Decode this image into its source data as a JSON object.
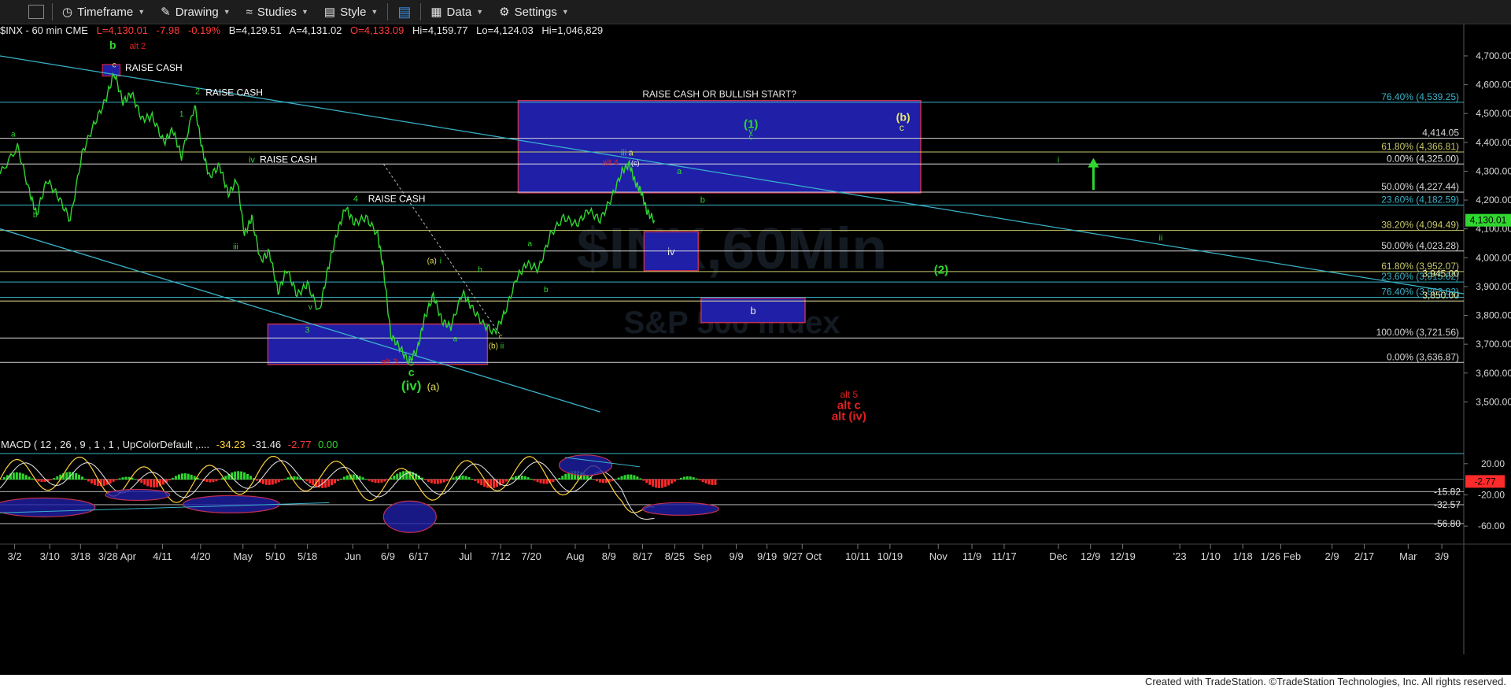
{
  "toolbar": {
    "timeframe": "Timeframe",
    "drawing": "Drawing",
    "studies": "Studies",
    "style": "Style",
    "data": "Data",
    "settings": "Settings"
  },
  "info": {
    "symbol": "$INX - 60 min  CME",
    "last": "L=4,130.01",
    "chg": "-7.98",
    "pct": "-0.19%",
    "bid": "B=4,129.51",
    "ask": "A=4,131.02",
    "open": "O=4,133.09",
    "high": "Hi=4,159.77",
    "low": "Lo=4,124.03",
    "vol": "Hi=1,046,829"
  },
  "footer": "Created with TradeStation. ©TradeStation Technologies, Inc. All rights reserved.",
  "watermark": {
    "line1": "$INX,60Min",
    "line2": "S&P 500 Index"
  },
  "chart_data": {
    "type": "line",
    "price_axis": {
      "ylim": [
        3430,
        4760
      ],
      "ticks": [
        3500,
        3600,
        3700,
        3800,
        3900,
        4000,
        4100,
        4200,
        4300,
        4400,
        4500,
        4600,
        4700
      ],
      "tick_labels": [
        "3,500.00",
        "3,600.00",
        "3,700.00",
        "3,800.00",
        "3,900.00",
        "4,000.00",
        "4,100.00",
        "4,200.00",
        "4,300.00",
        "4,400.00",
        "4,500.00",
        "4,600.00",
        "4,700.00"
      ],
      "last_label": "4,130.01"
    },
    "macd_axis": {
      "ylim": [
        -75,
        40
      ],
      "ticks": [
        20,
        -20,
        -60
      ],
      "tick_labels": [
        "20.00",
        "-20.00",
        "-60.00"
      ],
      "levels": [
        {
          "label": "-15.82",
          "value": -15.82
        },
        {
          "label": "-32.57",
          "value": -32.57
        },
        {
          "label": "-56.80",
          "value": -56.8
        }
      ],
      "last_label": "-2.77"
    },
    "macd_label": {
      "name": "MACD ( 12 , 26 , 9 , 1 , 1 , UpColorDefault ,....",
      "v1": "-34.23",
      "v2": "-31.46",
      "v3": "-2.77",
      "v4": "0.00"
    },
    "x_axis": {
      "labels": [
        {
          "t": 0.01,
          "l": "3/2"
        },
        {
          "t": 0.034,
          "l": "3/10"
        },
        {
          "t": 0.055,
          "l": "3/18"
        },
        {
          "t": 0.08,
          "l": "3/28 Apr"
        },
        {
          "t": 0.111,
          "l": "4/11"
        },
        {
          "t": 0.137,
          "l": "4/20"
        },
        {
          "t": 0.166,
          "l": "May"
        },
        {
          "t": 0.188,
          "l": "5/10"
        },
        {
          "t": 0.21,
          "l": "5/18"
        },
        {
          "t": 0.241,
          "l": "Jun"
        },
        {
          "t": 0.265,
          "l": "6/9"
        },
        {
          "t": 0.286,
          "l": "6/17"
        },
        {
          "t": 0.318,
          "l": "Jul"
        },
        {
          "t": 0.342,
          "l": "7/12"
        },
        {
          "t": 0.363,
          "l": "7/20"
        },
        {
          "t": 0.393,
          "l": "Aug"
        },
        {
          "t": 0.416,
          "l": "8/9"
        },
        {
          "t": 0.439,
          "l": "8/17"
        },
        {
          "t": 0.461,
          "l": "8/25"
        },
        {
          "t": 0.48,
          "l": "Sep"
        },
        {
          "t": 0.503,
          "l": "9/9"
        },
        {
          "t": 0.524,
          "l": "9/19"
        },
        {
          "t": 0.548,
          "l": "9/27 Oct"
        },
        {
          "t": 0.586,
          "l": "10/11"
        },
        {
          "t": 0.608,
          "l": "10/19"
        },
        {
          "t": 0.641,
          "l": "Nov"
        },
        {
          "t": 0.664,
          "l": "11/9"
        },
        {
          "t": 0.686,
          "l": "11/17"
        },
        {
          "t": 0.723,
          "l": "Dec"
        },
        {
          "t": 0.745,
          "l": "12/9"
        },
        {
          "t": 0.767,
          "l": "12/19"
        },
        {
          "t": 0.806,
          "l": "'23"
        },
        {
          "t": 0.827,
          "l": "1/10"
        },
        {
          "t": 0.849,
          "l": "1/18"
        },
        {
          "t": 0.875,
          "l": "1/26 Feb"
        },
        {
          "t": 0.91,
          "l": "2/9"
        },
        {
          "t": 0.932,
          "l": "2/17"
        },
        {
          "t": 0.962,
          "l": "Mar"
        },
        {
          "t": 0.985,
          "l": "3/9"
        }
      ]
    },
    "price_series": [
      [
        0.0,
        4290
      ],
      [
        0.012,
        4385
      ],
      [
        0.02,
        4230
      ],
      [
        0.025,
        4150
      ],
      [
        0.032,
        4270
      ],
      [
        0.04,
        4210
      ],
      [
        0.048,
        4130
      ],
      [
        0.056,
        4360
      ],
      [
        0.064,
        4460
      ],
      [
        0.072,
        4545
      ],
      [
        0.078,
        4640
      ],
      [
        0.084,
        4540
      ],
      [
        0.09,
        4570
      ],
      [
        0.097,
        4480
      ],
      [
        0.104,
        4490
      ],
      [
        0.112,
        4400
      ],
      [
        0.118,
        4445
      ],
      [
        0.124,
        4350
      ],
      [
        0.133,
        4530
      ],
      [
        0.138,
        4380
      ],
      [
        0.143,
        4280
      ],
      [
        0.15,
        4320
      ],
      [
        0.156,
        4220
      ],
      [
        0.162,
        4270
      ],
      [
        0.167,
        4080
      ],
      [
        0.172,
        4140
      ],
      [
        0.178,
        3990
      ],
      [
        0.184,
        4020
      ],
      [
        0.19,
        3880
      ],
      [
        0.196,
        3960
      ],
      [
        0.203,
        3870
      ],
      [
        0.21,
        3910
      ],
      [
        0.218,
        3810
      ],
      [
        0.224,
        3960
      ],
      [
        0.23,
        4080
      ],
      [
        0.236,
        4175
      ],
      [
        0.242,
        4120
      ],
      [
        0.25,
        4140
      ],
      [
        0.258,
        4080
      ],
      [
        0.262,
        3960
      ],
      [
        0.267,
        3730
      ],
      [
        0.273,
        3690
      ],
      [
        0.279,
        3640
      ],
      [
        0.285,
        3680
      ],
      [
        0.29,
        3790
      ],
      [
        0.296,
        3870
      ],
      [
        0.302,
        3780
      ],
      [
        0.308,
        3760
      ],
      [
        0.316,
        3880
      ],
      [
        0.322,
        3830
      ],
      [
        0.33,
        3770
      ],
      [
        0.338,
        3740
      ],
      [
        0.345,
        3810
      ],
      [
        0.353,
        3930
      ],
      [
        0.36,
        3980
      ],
      [
        0.368,
        3960
      ],
      [
        0.376,
        4080
      ],
      [
        0.385,
        4140
      ],
      [
        0.394,
        4115
      ],
      [
        0.402,
        4165
      ],
      [
        0.41,
        4130
      ],
      [
        0.418,
        4210
      ],
      [
        0.425,
        4300
      ],
      [
        0.43,
        4325
      ],
      [
        0.434,
        4260
      ],
      [
        0.438,
        4230
      ],
      [
        0.442,
        4160
      ],
      [
        0.447,
        4130
      ]
    ],
    "fib_levels": [
      {
        "value": 4539.25,
        "label": "76.40% (4,539.25)",
        "color": "#3ab3c9"
      },
      {
        "value": 4414.05,
        "label": "4,414.05",
        "color": "#d8d8d8"
      },
      {
        "value": 4366.81,
        "label": "61.80% (4,366.81)",
        "color": "#c8c86a"
      },
      {
        "value": 4325.0,
        "label": "0.00% (4,325.00)",
        "color": "#e0e0e0"
      },
      {
        "value": 4227.44,
        "label": "50.00% (4,227.44)",
        "color": "#d8d8d8"
      },
      {
        "value": 4182.59,
        "label": "23.60% (4,182.59)",
        "color": "#3ab3c9"
      },
      {
        "value": 4094.49,
        "label": "38.20% (4,094.49)",
        "color": "#c8c86a"
      },
      {
        "value": 4023.28,
        "label": "50.00% (4,023.28)",
        "color": "#d8d8d8"
      },
      {
        "value": 3952.0,
        "label": "61.80% (3,952.07)",
        "color": "#c8c86a"
      },
      {
        "value": 3915.62,
        "label": "23.60% (3,915.62)",
        "color": "#3ab3c9"
      },
      {
        "value": 3863.0,
        "label": "76.40% (3,863.82)",
        "color": "#3ab3c9"
      },
      {
        "value": 3850.0,
        "label": "3,850.00",
        "color": "#e8e8a0"
      },
      {
        "value": 3721.56,
        "label": "100.00% (3,721.56)",
        "color": "#d8d8d8"
      },
      {
        "value": 3636.87,
        "label": "0.00% (3,636.87)",
        "color": "#d8d8d8"
      }
    ],
    "extra_labels": [
      {
        "value": 3945.0,
        "label": "3,945.00",
        "color": "#e8e8a0"
      }
    ],
    "target_boxes": [
      {
        "t0": 0.07,
        "t1": 0.082,
        "y0": 4630,
        "y1": 4670,
        "color": "#b02040",
        "label": ""
      },
      {
        "t0": 0.354,
        "t1": 0.629,
        "y0": 4225,
        "y1": 4545,
        "color": "#c03050",
        "label": "RAISE CASH OR BULLISH START?"
      },
      {
        "t0": 0.44,
        "t1": 0.477,
        "y0": 3955,
        "y1": 4090,
        "color": "#c03050",
        "label": "iv"
      },
      {
        "t0": 0.479,
        "t1": 0.55,
        "y0": 3775,
        "y1": 3860,
        "color": "#c03050",
        "label": "b"
      },
      {
        "t0": 0.183,
        "t1": 0.333,
        "y0": 3630,
        "y1": 3770,
        "color": "#c03050",
        "label": ""
      }
    ],
    "trendlines": [
      {
        "t0": 0.0,
        "y0": 4700,
        "t1": 1.0,
        "y1": 3875,
        "color": "#3ab3c9"
      },
      {
        "t0": 0.0,
        "y0": 4100,
        "t1": 0.41,
        "y1": 3465,
        "color": "#3ab3c9"
      }
    ],
    "annotations": [
      {
        "t": 0.077,
        "p": 4725,
        "text": "b",
        "color": "#2fd72f",
        "size": 14
      },
      {
        "t": 0.094,
        "p": 4725,
        "text": "alt 2",
        "color": "#e02020",
        "size": 11
      },
      {
        "t": 0.078,
        "p": 4660,
        "text": "c",
        "color": "#dddd55",
        "size": 10
      },
      {
        "t": 0.105,
        "p": 4648,
        "text": "RAISE CASH",
        "color": "#ffffff",
        "size": 12
      },
      {
        "t": 0.135,
        "p": 4568,
        "text": "2",
        "color": "#2fd72f",
        "size": 11
      },
      {
        "t": 0.16,
        "p": 4562,
        "text": "RAISE CASH",
        "color": "#ffffff",
        "size": 12
      },
      {
        "t": 0.124,
        "p": 4490,
        "text": "1",
        "color": "#2fd72f",
        "size": 10
      },
      {
        "t": 0.009,
        "p": 4420,
        "text": "a",
        "color": "#2fd72f",
        "size": 10
      },
      {
        "t": 0.172,
        "p": 4330,
        "text": "iv",
        "color": "#2fd72f",
        "size": 11
      },
      {
        "t": 0.197,
        "p": 4330,
        "text": "RAISE CASH",
        "color": "#ffffff",
        "size": 12
      },
      {
        "t": 0.024,
        "p": 4140,
        "text": "b",
        "color": "#2fd72f",
        "size": 10
      },
      {
        "t": 0.243,
        "p": 4195,
        "text": "4",
        "color": "#2fd72f",
        "size": 11
      },
      {
        "t": 0.271,
        "p": 4193,
        "text": "RAISE CASH",
        "color": "#ffffff",
        "size": 12
      },
      {
        "t": 0.161,
        "p": 4030,
        "text": "iii",
        "color": "#2fd72f",
        "size": 10
      },
      {
        "t": 0.212,
        "p": 3820,
        "text": "v",
        "color": "#2fd72f",
        "size": 10
      },
      {
        "t": 0.21,
        "p": 3740,
        "text": "3",
        "color": "#2fd72f",
        "size": 11
      },
      {
        "t": 0.295,
        "p": 3980,
        "text": "(a)",
        "color": "#dddd55",
        "size": 10
      },
      {
        "t": 0.301,
        "p": 3980,
        "text": "i",
        "color": "#2fd72f",
        "size": 10
      },
      {
        "t": 0.328,
        "p": 3950,
        "text": "b",
        "color": "#2fd72f",
        "size": 10
      },
      {
        "t": 0.311,
        "p": 3710,
        "text": "a",
        "color": "#2fd72f",
        "size": 10
      },
      {
        "t": 0.362,
        "p": 4040,
        "text": "a",
        "color": "#2fd72f",
        "size": 10
      },
      {
        "t": 0.373,
        "p": 3880,
        "text": "b",
        "color": "#2fd72f",
        "size": 10
      },
      {
        "t": 0.337,
        "p": 3685,
        "text": "(b)",
        "color": "#dddd55",
        "size": 10
      },
      {
        "t": 0.343,
        "p": 3685,
        "text": "ii",
        "color": "#2fd72f",
        "size": 10
      },
      {
        "t": 0.342,
        "p": 3720,
        "text": "c",
        "color": "#dddd55",
        "size": 9
      },
      {
        "t": 0.266,
        "p": 3630,
        "text": "alt 3",
        "color": "#e02020",
        "size": 11
      },
      {
        "t": 0.281,
        "p": 3625,
        "text": "5",
        "color": "#2fd72f",
        "size": 12
      },
      {
        "t": 0.281,
        "p": 3590,
        "text": "c",
        "color": "#2fd72f",
        "size": 14
      },
      {
        "t": 0.281,
        "p": 3540,
        "text": "(iv)",
        "color": "#2fd72f",
        "size": 17
      },
      {
        "t": 0.296,
        "p": 3540,
        "text": "(a)",
        "color": "#dddd55",
        "size": 13
      },
      {
        "t": 0.426,
        "p": 4355,
        "text": "iii",
        "color": "#2fd72f",
        "size": 11
      },
      {
        "t": 0.431,
        "p": 4355,
        "text": "a",
        "color": "#dddd55",
        "size": 11
      },
      {
        "t": 0.417,
        "p": 4320,
        "text": "alt 4",
        "color": "#e02020",
        "size": 11
      },
      {
        "t": 0.434,
        "p": 4320,
        "text": "(c)",
        "color": "#ffffff",
        "size": 9
      },
      {
        "t": 0.464,
        "p": 4290,
        "text": "a",
        "color": "#2fd72f",
        "size": 11
      },
      {
        "t": 0.48,
        "p": 4190,
        "text": "b",
        "color": "#2fd72f",
        "size": 11
      },
      {
        "t": 0.513,
        "p": 4450,
        "text": "(1)",
        "color": "#2fd72f",
        "size": 15
      },
      {
        "t": 0.513,
        "p": 4428,
        "text": "v",
        "color": "#2fd72f",
        "size": 11
      },
      {
        "t": 0.513,
        "p": 4410,
        "text": "c",
        "color": "#2fd72f",
        "size": 11
      },
      {
        "t": 0.617,
        "p": 4475,
        "text": "(b)",
        "color": "#e8e870",
        "size": 14
      },
      {
        "t": 0.616,
        "p": 4440,
        "text": "c",
        "color": "#e8e870",
        "size": 12
      },
      {
        "t": 0.723,
        "p": 4330,
        "text": "i",
        "color": "#2fd72f",
        "size": 11
      },
      {
        "t": 0.643,
        "p": 3945,
        "text": "(2)",
        "color": "#2fd72f",
        "size": 15
      },
      {
        "t": 0.793,
        "p": 4060,
        "text": "ii",
        "color": "#2fd72f",
        "size": 11
      },
      {
        "t": 0.58,
        "p": 3515,
        "text": "alt 5",
        "color": "#e02020",
        "size": 12
      },
      {
        "t": 0.58,
        "p": 3475,
        "text": "alt c",
        "color": "#e02020",
        "size": 15
      },
      {
        "t": 0.58,
        "p": 3437,
        "text": "alt (iv)",
        "color": "#e02020",
        "size": 15
      }
    ],
    "arrow": {
      "t": 0.747,
      "p0": 4235,
      "p1": 4335,
      "color": "#2fd72f"
    }
  }
}
